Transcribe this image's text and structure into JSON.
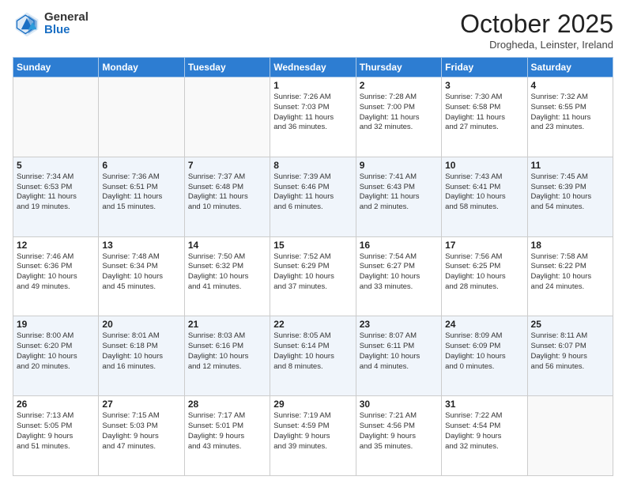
{
  "logo": {
    "general": "General",
    "blue": "Blue"
  },
  "title": "October 2025",
  "subtitle": "Drogheda, Leinster, Ireland",
  "days_of_week": [
    "Sunday",
    "Monday",
    "Tuesday",
    "Wednesday",
    "Thursday",
    "Friday",
    "Saturday"
  ],
  "weeks": [
    [
      {
        "day": "",
        "detail": ""
      },
      {
        "day": "",
        "detail": ""
      },
      {
        "day": "",
        "detail": ""
      },
      {
        "day": "1",
        "detail": "Sunrise: 7:26 AM\nSunset: 7:03 PM\nDaylight: 11 hours\nand 36 minutes."
      },
      {
        "day": "2",
        "detail": "Sunrise: 7:28 AM\nSunset: 7:00 PM\nDaylight: 11 hours\nand 32 minutes."
      },
      {
        "day": "3",
        "detail": "Sunrise: 7:30 AM\nSunset: 6:58 PM\nDaylight: 11 hours\nand 27 minutes."
      },
      {
        "day": "4",
        "detail": "Sunrise: 7:32 AM\nSunset: 6:55 PM\nDaylight: 11 hours\nand 23 minutes."
      }
    ],
    [
      {
        "day": "5",
        "detail": "Sunrise: 7:34 AM\nSunset: 6:53 PM\nDaylight: 11 hours\nand 19 minutes."
      },
      {
        "day": "6",
        "detail": "Sunrise: 7:36 AM\nSunset: 6:51 PM\nDaylight: 11 hours\nand 15 minutes."
      },
      {
        "day": "7",
        "detail": "Sunrise: 7:37 AM\nSunset: 6:48 PM\nDaylight: 11 hours\nand 10 minutes."
      },
      {
        "day": "8",
        "detail": "Sunrise: 7:39 AM\nSunset: 6:46 PM\nDaylight: 11 hours\nand 6 minutes."
      },
      {
        "day": "9",
        "detail": "Sunrise: 7:41 AM\nSunset: 6:43 PM\nDaylight: 11 hours\nand 2 minutes."
      },
      {
        "day": "10",
        "detail": "Sunrise: 7:43 AM\nSunset: 6:41 PM\nDaylight: 10 hours\nand 58 minutes."
      },
      {
        "day": "11",
        "detail": "Sunrise: 7:45 AM\nSunset: 6:39 PM\nDaylight: 10 hours\nand 54 minutes."
      }
    ],
    [
      {
        "day": "12",
        "detail": "Sunrise: 7:46 AM\nSunset: 6:36 PM\nDaylight: 10 hours\nand 49 minutes."
      },
      {
        "day": "13",
        "detail": "Sunrise: 7:48 AM\nSunset: 6:34 PM\nDaylight: 10 hours\nand 45 minutes."
      },
      {
        "day": "14",
        "detail": "Sunrise: 7:50 AM\nSunset: 6:32 PM\nDaylight: 10 hours\nand 41 minutes."
      },
      {
        "day": "15",
        "detail": "Sunrise: 7:52 AM\nSunset: 6:29 PM\nDaylight: 10 hours\nand 37 minutes."
      },
      {
        "day": "16",
        "detail": "Sunrise: 7:54 AM\nSunset: 6:27 PM\nDaylight: 10 hours\nand 33 minutes."
      },
      {
        "day": "17",
        "detail": "Sunrise: 7:56 AM\nSunset: 6:25 PM\nDaylight: 10 hours\nand 28 minutes."
      },
      {
        "day": "18",
        "detail": "Sunrise: 7:58 AM\nSunset: 6:22 PM\nDaylight: 10 hours\nand 24 minutes."
      }
    ],
    [
      {
        "day": "19",
        "detail": "Sunrise: 8:00 AM\nSunset: 6:20 PM\nDaylight: 10 hours\nand 20 minutes."
      },
      {
        "day": "20",
        "detail": "Sunrise: 8:01 AM\nSunset: 6:18 PM\nDaylight: 10 hours\nand 16 minutes."
      },
      {
        "day": "21",
        "detail": "Sunrise: 8:03 AM\nSunset: 6:16 PM\nDaylight: 10 hours\nand 12 minutes."
      },
      {
        "day": "22",
        "detail": "Sunrise: 8:05 AM\nSunset: 6:14 PM\nDaylight: 10 hours\nand 8 minutes."
      },
      {
        "day": "23",
        "detail": "Sunrise: 8:07 AM\nSunset: 6:11 PM\nDaylight: 10 hours\nand 4 minutes."
      },
      {
        "day": "24",
        "detail": "Sunrise: 8:09 AM\nSunset: 6:09 PM\nDaylight: 10 hours\nand 0 minutes."
      },
      {
        "day": "25",
        "detail": "Sunrise: 8:11 AM\nSunset: 6:07 PM\nDaylight: 9 hours\nand 56 minutes."
      }
    ],
    [
      {
        "day": "26",
        "detail": "Sunrise: 7:13 AM\nSunset: 5:05 PM\nDaylight: 9 hours\nand 51 minutes."
      },
      {
        "day": "27",
        "detail": "Sunrise: 7:15 AM\nSunset: 5:03 PM\nDaylight: 9 hours\nand 47 minutes."
      },
      {
        "day": "28",
        "detail": "Sunrise: 7:17 AM\nSunset: 5:01 PM\nDaylight: 9 hours\nand 43 minutes."
      },
      {
        "day": "29",
        "detail": "Sunrise: 7:19 AM\nSunset: 4:59 PM\nDaylight: 9 hours\nand 39 minutes."
      },
      {
        "day": "30",
        "detail": "Sunrise: 7:21 AM\nSunset: 4:56 PM\nDaylight: 9 hours\nand 35 minutes."
      },
      {
        "day": "31",
        "detail": "Sunrise: 7:22 AM\nSunset: 4:54 PM\nDaylight: 9 hours\nand 32 minutes."
      },
      {
        "day": "",
        "detail": ""
      }
    ]
  ]
}
